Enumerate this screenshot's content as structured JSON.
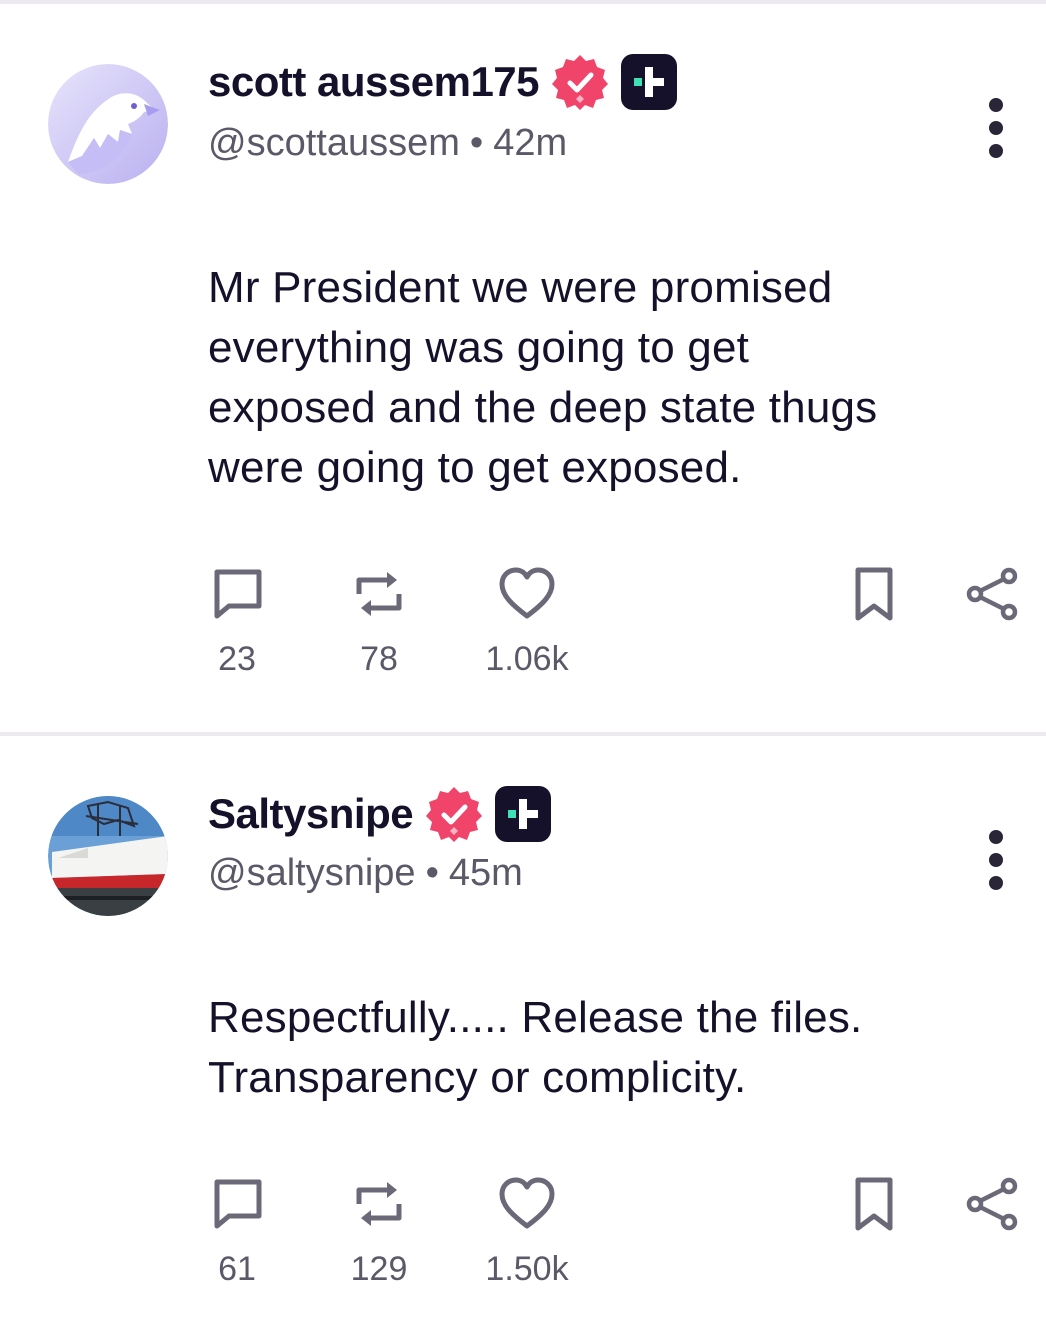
{
  "posts": [
    {
      "display_name": "scott aussem175",
      "handle": "@scottaussem",
      "separator": "•",
      "time": "42m",
      "avatar": "eagle-avatar",
      "body_lines": [
        "Mr President we were promised",
        "everything was going to get",
        "exposed and the deep state thugs",
        "were going to get exposed."
      ],
      "replies": "23",
      "reposts": "78",
      "likes": "1.06k"
    },
    {
      "display_name": "Saltysnipe",
      "handle": "@saltysnipe",
      "separator": "•",
      "time": "45m",
      "avatar": "ship-photo-avatar",
      "body_lines": [
        "Respectfully..... Release the files.",
        "Transparency or complicity."
      ],
      "replies": "61",
      "reposts": "129",
      "likes": "1.50k"
    }
  ],
  "icons": {
    "verified": "verified-badge-icon",
    "plus": "plus-badge-icon",
    "more": "more-vertical-icon",
    "reply": "comment-icon",
    "repost": "repost-icon",
    "like": "heart-icon",
    "bookmark": "bookmark-icon",
    "share": "share-icon"
  },
  "colors": {
    "verified": "#f0446a",
    "plus_badge_bg": "#15112a",
    "plus_badge_accent": "#3ee0b5",
    "text_primary": "#15112a",
    "text_secondary": "#5b5868",
    "icon": "#6b6878",
    "divider": "#eceaf0"
  }
}
